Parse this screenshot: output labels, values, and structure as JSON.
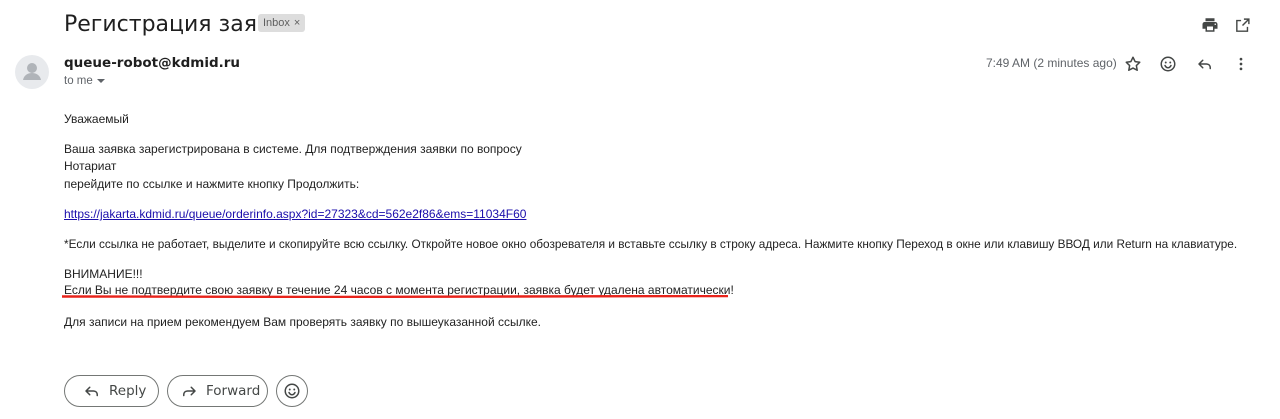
{
  "header": {
    "subject": "Регистрация заявки",
    "label_badge": "Inbox",
    "label_badge_close": "×"
  },
  "message": {
    "sender": "queue-robot@kdmid.ru",
    "to_label": "to me",
    "time": "7:49 AM (2 minutes ago)"
  },
  "body": {
    "greeting": "Уважаемый",
    "line1": "Ваша заявка зарегистрирована в системе. Для подтверждения заявки по вопросу",
    "line2": "Нотариат",
    "line3": "перейдите по ссылке и нажмите кнопку Продолжить:",
    "link": "https://jakarta.kdmid.ru/queue/orderinfo.aspx?id=27323&cd=562e2f86&ems=11034F60",
    "note": "*Если ссылка не работает, выделите и скопируйте всю ссылку. Откройте новое окно обозревателя и вставьте ссылку в строку адреса. Нажмите кнопку Переход в окне или клавишу ВВОД или Return на клавиатуре.",
    "warning_title": "ВНИМАНИЕ!!!",
    "warning_text": "Если Вы не подтвердите свою заявку в течение 24 часов с момента регистрации, заявка будет удалена автоматически!",
    "footer": "Для записи на прием рекомендуем Вам проверять заявку по вышеуказанной ссылке."
  },
  "actions": {
    "reply": "Reply",
    "forward": "Forward"
  },
  "colors": {
    "underline": "#e8231b",
    "link": "#1a0dab"
  },
  "icons": [
    "print-icon",
    "open-in-new-icon",
    "avatar-icon",
    "star-icon",
    "emoji-icon",
    "reply-icon",
    "more-vert-icon",
    "forward-icon"
  ]
}
